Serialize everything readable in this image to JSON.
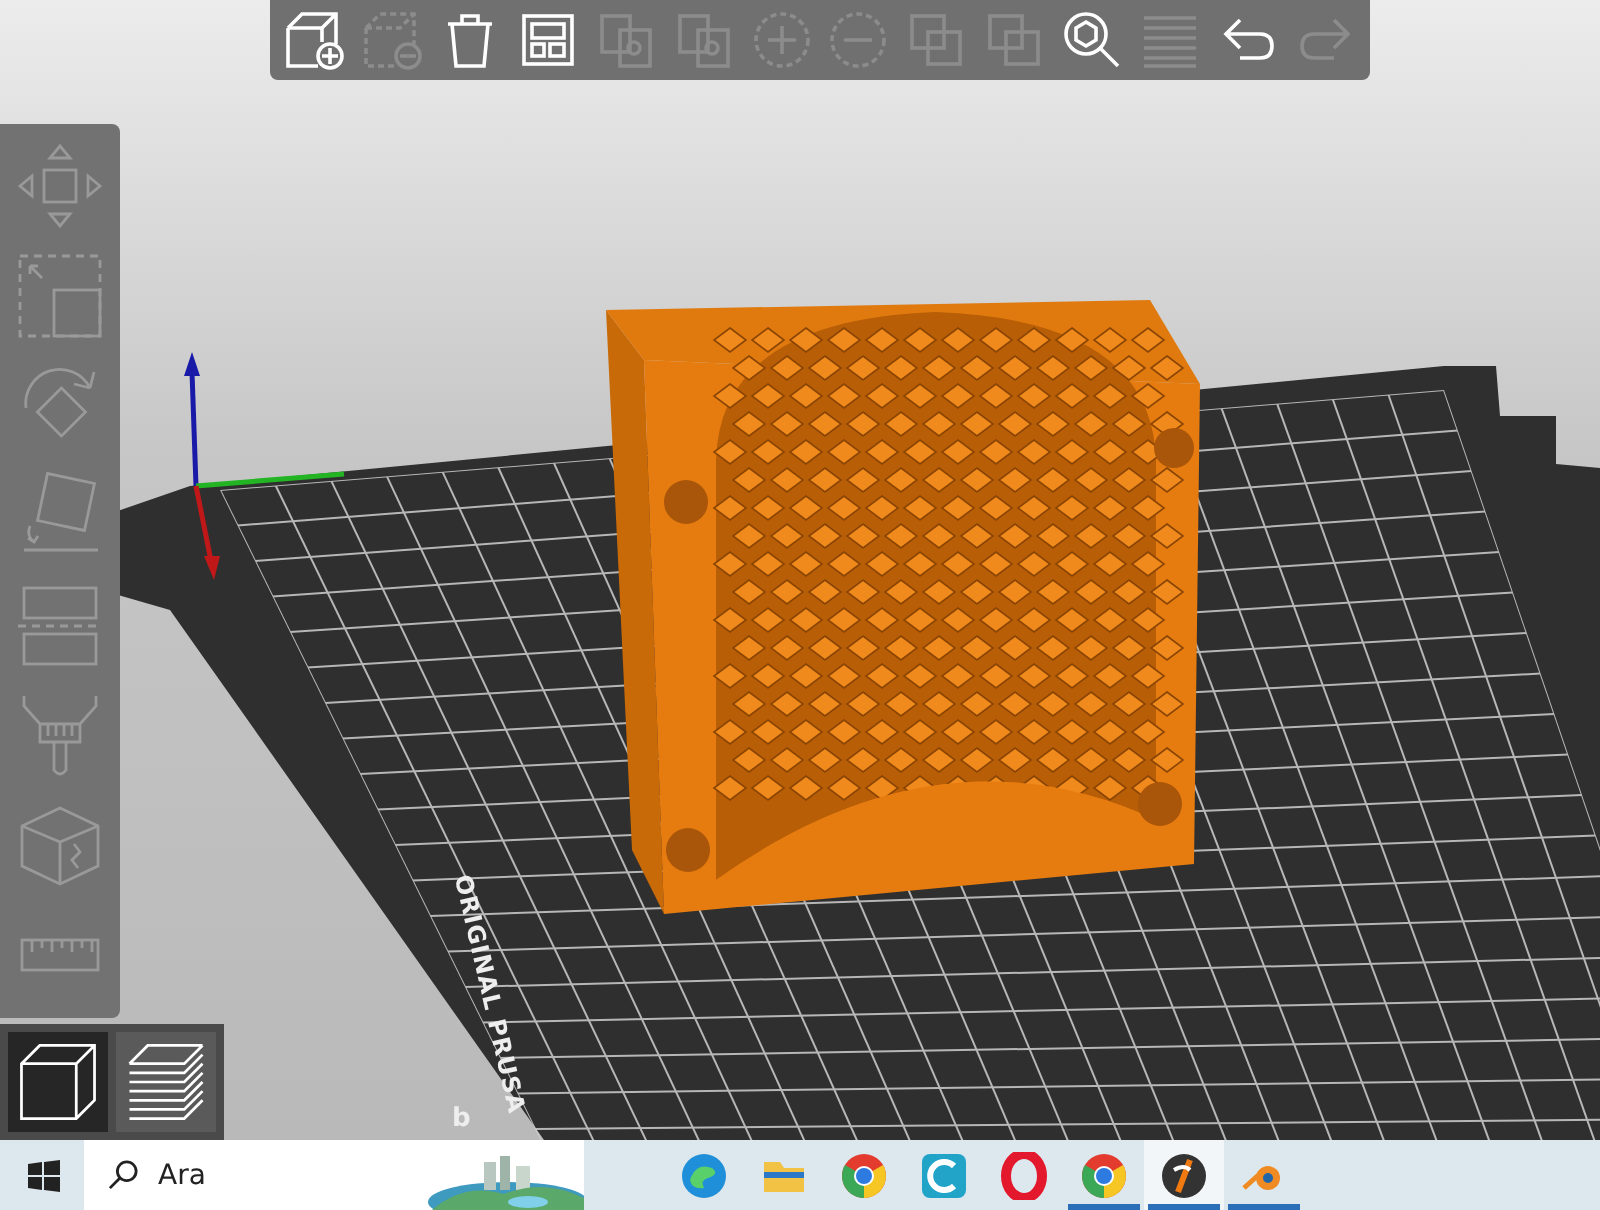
{
  "top_toolbar": [
    {
      "kind": "add",
      "enabled": true
    },
    {
      "kind": "remove",
      "enabled": false
    },
    {
      "kind": "delete",
      "enabled": true
    },
    {
      "kind": "arrange",
      "enabled": true
    },
    {
      "kind": "copy",
      "enabled": false
    },
    {
      "kind": "paste",
      "enabled": false
    },
    {
      "kind": "plus",
      "enabled": false
    },
    {
      "kind": "minus",
      "enabled": false
    },
    {
      "kind": "split",
      "enabled": false
    },
    {
      "kind": "parts",
      "enabled": false
    },
    {
      "kind": "search",
      "enabled": true
    },
    {
      "kind": "layers",
      "enabled": false
    },
    {
      "kind": "undo",
      "enabled": true
    },
    {
      "kind": "redo",
      "enabled": false
    }
  ],
  "left_toolbar": [
    {
      "kind": "move",
      "enabled": false
    },
    {
      "kind": "scale",
      "enabled": false
    },
    {
      "kind": "rotate",
      "enabled": false
    },
    {
      "kind": "face",
      "enabled": false
    },
    {
      "kind": "cut",
      "enabled": false
    },
    {
      "kind": "paint",
      "enabled": false
    },
    {
      "kind": "seam",
      "enabled": false
    },
    {
      "kind": "measure",
      "enabled": false
    }
  ],
  "view_toggle": [
    {
      "kind": "solid",
      "selected": true
    },
    {
      "kind": "preview",
      "selected": false
    }
  ],
  "bed": {
    "label": "ORIGINAL PRUSA",
    "label_2": "b"
  },
  "taskbar": {
    "search": {
      "placeholder": "Ara"
    },
    "apps": [
      {
        "kind": "swirl",
        "running": false,
        "selected": false
      },
      {
        "kind": "folder",
        "running": false,
        "selected": false
      },
      {
        "kind": "chrome",
        "running": false,
        "selected": false
      },
      {
        "kind": "crescent",
        "running": false,
        "selected": false
      },
      {
        "kind": "ring",
        "running": false,
        "selected": false
      },
      {
        "kind": "chrome",
        "running": true,
        "selected": false
      },
      {
        "kind": "slicer",
        "running": true,
        "selected": true
      },
      {
        "kind": "orbit",
        "running": true,
        "selected": false
      }
    ]
  }
}
